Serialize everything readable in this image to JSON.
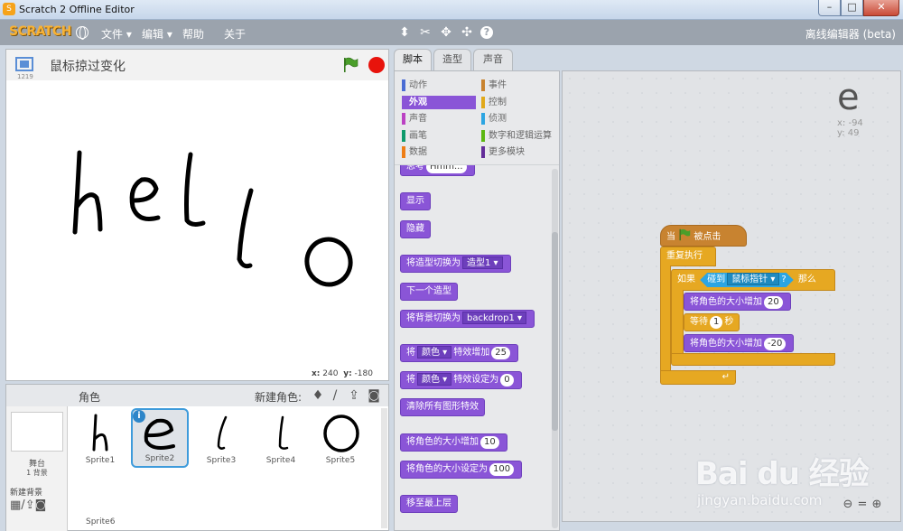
{
  "window": {
    "title": "Scratch 2 Offline Editor"
  },
  "menubar": {
    "logo": "SCRATCH",
    "file": "文件 ▾",
    "edit": "编辑 ▾",
    "help": "帮助",
    "about": "关于",
    "edition": "离线编辑器 (beta)",
    "tools": [
      "duplicate-icon",
      "delete-icon",
      "grow-icon",
      "shrink-icon",
      "help-icon"
    ]
  },
  "stage": {
    "project_title": "鼠标掠过变化",
    "version": "1219",
    "mouse_x_label": "x:",
    "mouse_x": "240",
    "mouse_y_label": "y:",
    "mouse_y": "-180"
  },
  "sprites": {
    "header": "角色",
    "new_sprite": "新建角色:",
    "stage_label": "舞台",
    "backdrop_count": "1 背景",
    "new_backdrop": "新建背景",
    "items": [
      {
        "name": "Sprite1",
        "glyph": "h"
      },
      {
        "name": "Sprite2",
        "glyph": "e",
        "selected": true
      },
      {
        "name": "Sprite3",
        "glyph": "l"
      },
      {
        "name": "Sprite4",
        "glyph": "l"
      },
      {
        "name": "Sprite5",
        "glyph": "o"
      },
      {
        "name": "Sprite6"
      }
    ]
  },
  "tabs": {
    "scripts": "脚本",
    "costumes": "造型",
    "sounds": "声音"
  },
  "categories": [
    {
      "label": "动作",
      "color": "#4a6cd4"
    },
    {
      "label": "事件",
      "color": "#c88330"
    },
    {
      "label": "外观",
      "color": "#8a55d7",
      "selected": true
    },
    {
      "label": "控制",
      "color": "#e1a91a"
    },
    {
      "label": "声音",
      "color": "#bb42c3"
    },
    {
      "label": "侦测",
      "color": "#2ca5e2"
    },
    {
      "label": "画笔",
      "color": "#0e9a6c"
    },
    {
      "label": "数字和逻辑运算",
      "color": "#5cb712"
    },
    {
      "label": "数据",
      "color": "#ee7d16"
    },
    {
      "label": "更多模块",
      "color": "#632d99"
    }
  ],
  "palette": {
    "think_text": "思考",
    "think_value": "Hmm...",
    "show": "显示",
    "hide": "隐藏",
    "switch_costume": "将造型切换为",
    "costume_value": "造型1",
    "next_costume": "下一个造型",
    "switch_backdrop": "将背景切换为",
    "backdrop_value": "backdrop1",
    "effect_change_pre": "将",
    "effect_value": "颜色",
    "effect_change_post": "特效增加",
    "effect_change_amount": "25",
    "effect_set_pre": "将",
    "effect_set_value": "颜色",
    "effect_set_post": "特效设定为",
    "effect_set_amount": "0",
    "clear_effects": "清除所有图形特效",
    "size_change": "将角色的大小增加",
    "size_change_amount": "10",
    "size_set": "将角色的大小设定为",
    "size_set_amount": "100",
    "front": "移至最上层"
  },
  "script": {
    "hat_when": "当",
    "hat_clicked": "被点击",
    "forever": "重复执行",
    "if": "如果",
    "touching": "碰到",
    "touch_target": "鼠标指针",
    "question": "?",
    "then": "那么",
    "size_up": "将角色的大小增加",
    "size_up_amount": "20",
    "wait": "等待",
    "wait_amount": "1",
    "seconds": "秒",
    "size_down": "将角色的大小增加",
    "size_down_amount": "-20"
  },
  "sprite_info": {
    "glyph": "e",
    "x": "x: -94",
    "y": "y: 49"
  },
  "watermark": {
    "brand": "Bai du 经验",
    "url": "jingyan.baidu.com"
  }
}
